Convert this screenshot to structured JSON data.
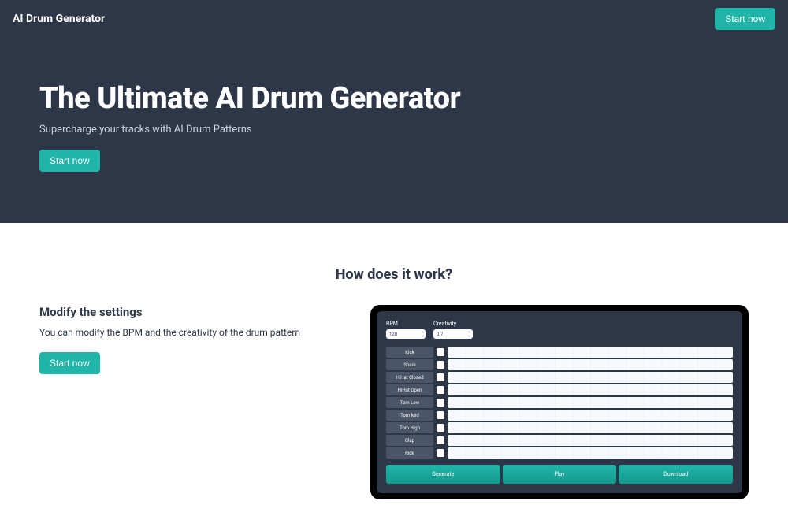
{
  "header": {
    "title": "AI Drum Generator",
    "cta": "Start now"
  },
  "hero": {
    "title": "The Ultimate AI Drum Generator",
    "subtitle": "Supercharge your tracks with AI Drum Patterns",
    "cta": "Start now"
  },
  "how_it_works": {
    "heading": "How does it work?",
    "modify_title": "Modify the settings",
    "modify_text": "You can modify the BPM and the creativity of the drum pattern",
    "cta": "Start now"
  },
  "app": {
    "controls": {
      "bpm_label": "BPM",
      "bpm_value": "120",
      "creativity_label": "Creativity",
      "creativity_value": "0.7"
    },
    "tracks": [
      "Kick",
      "Snare",
      "HiHat Closed",
      "HiHat Open",
      "Tom Low",
      "Tom Mid",
      "Tom High",
      "Clap",
      "Ride"
    ],
    "buttons": {
      "generate": "Generate",
      "play": "Play",
      "download": "Download"
    }
  }
}
